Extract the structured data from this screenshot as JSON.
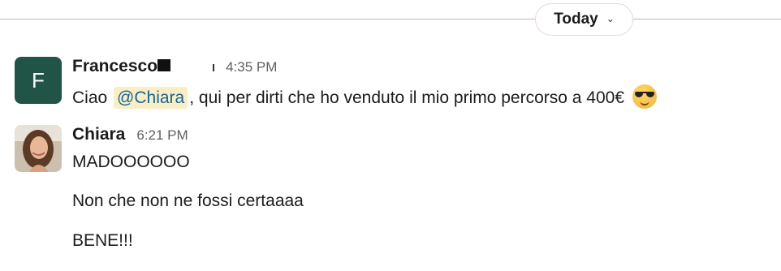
{
  "day_divider": {
    "label": "Today",
    "chevron": "chevron-down-icon"
  },
  "messages": [
    {
      "sender": "Francesco",
      "avatar_letter": "F",
      "avatar_color": "#1f5446",
      "time": "4:35 PM",
      "text_before": "Ciao",
      "mention": "@Chiara",
      "text_after": ", qui per dirti che ho venduto il mio primo percorso a 400€",
      "emoji": "sunglasses-emoji"
    },
    {
      "sender": "Chiara",
      "time": "6:21 PM",
      "lines": [
        "MADOOOOOO",
        "Non che non ne fossi certaaaa",
        "BENE!!!"
      ]
    }
  ]
}
